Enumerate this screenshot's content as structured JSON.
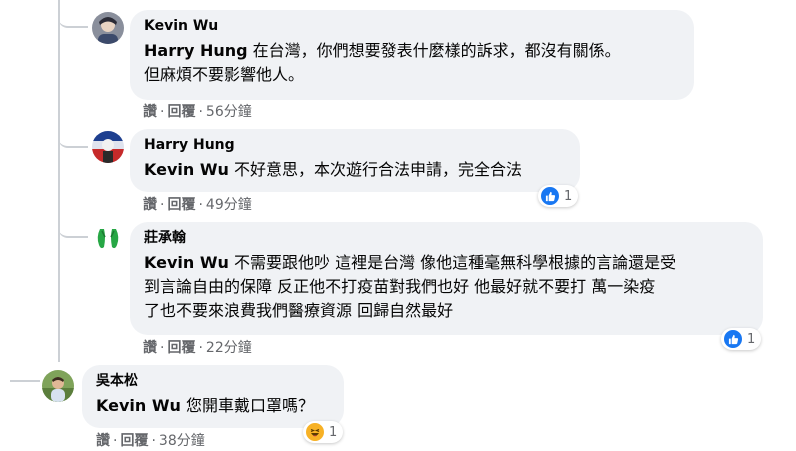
{
  "comments": [
    {
      "author": "Kevin Wu",
      "mention": "Harry Hung",
      "text_line1": " 在台灣，你們想要發表什麼樣的訴求，都沒有關係。",
      "text_line2": "但麻煩不要影響他人。",
      "actions": {
        "like": "讚",
        "reply": "回覆",
        "time": "56分鐘"
      }
    },
    {
      "author": "Harry Hung",
      "mention": "Kevin Wu",
      "text_line1": " 不好意思，本次遊行合法申請，完全合法",
      "actions": {
        "like": "讚",
        "reply": "回覆",
        "time": "49分鐘"
      },
      "reaction": {
        "icon": "like-icon",
        "count": "1"
      }
    },
    {
      "author": "莊承翰",
      "mention": "Kevin Wu",
      "text_line1": " 不需要跟他吵 這裡是台灣 像他這種毫無科學根據的言論還是受",
      "text_line2": "到言論自由的保障 反正他不打疫苗對我們也好 他最好就不要打 萬一染疫",
      "text_line3": "了也不要來浪費我們醫療資源 回歸自然最好",
      "actions": {
        "like": "讚",
        "reply": "回覆",
        "time": "22分鐘"
      },
      "reaction": {
        "icon": "like-icon",
        "count": "1"
      }
    },
    {
      "author": "吳本松",
      "mention": "Kevin Wu",
      "text_line1": " 您開車戴口罩嗎？",
      "actions": {
        "like": "讚",
        "reply": "回覆",
        "time": "38分鐘"
      },
      "reaction": {
        "icon": "haha-icon",
        "count": "1"
      }
    }
  ],
  "separator": "·",
  "colors": {
    "bubble": "#f0f2f5",
    "meta": "#65676b",
    "like_blue": "#1877f2",
    "haha_yellow": "#f7b125",
    "thread": "#ccd0d5"
  }
}
